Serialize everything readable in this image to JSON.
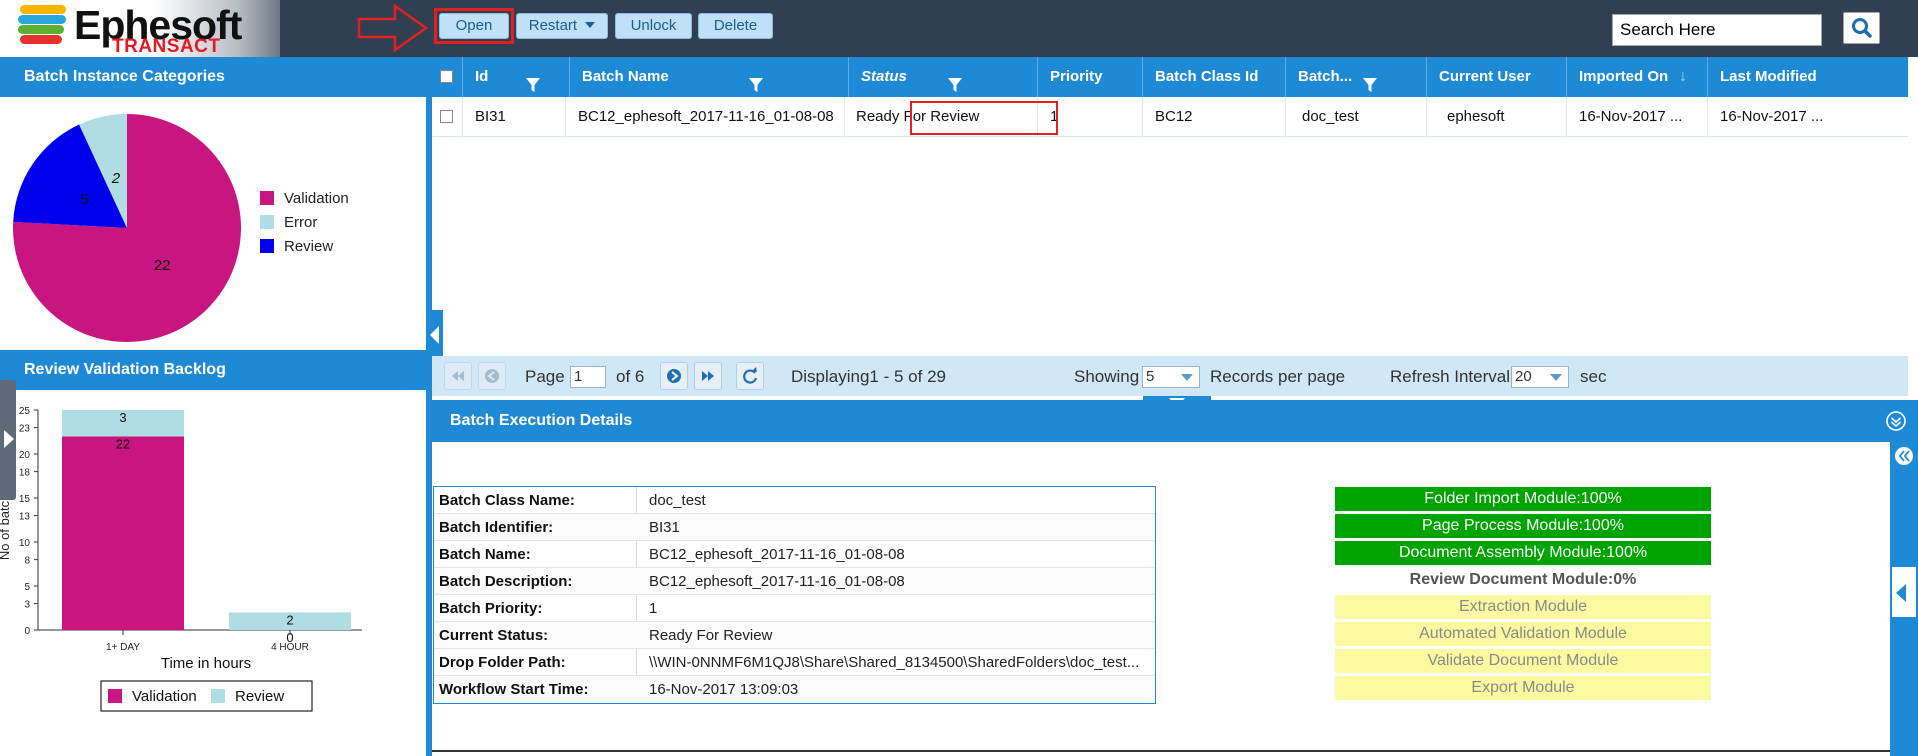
{
  "app": {
    "logo_title": "Ephesoft",
    "logo_sub": "TRANSACT"
  },
  "toolbar": {
    "open": "Open",
    "restart": "Restart",
    "unlock": "Unlock",
    "delete": "Delete"
  },
  "search": {
    "placeholder": "Search Here"
  },
  "left": {
    "categories_title": "Batch Instance Categories",
    "backlog_title": "Review Validation Backlog",
    "pie": {
      "slices": [
        {
          "name": "Validation",
          "value": 22,
          "color": "#c8157f"
        },
        {
          "name": "Error",
          "value": 2,
          "color": "#b0dde4"
        },
        {
          "name": "Review",
          "value": 5,
          "color": "#0000ee"
        }
      ]
    },
    "backlog": {
      "ylabel": "No of batches",
      "xlabel": "Time in hours",
      "yticks": [
        "25",
        "23",
        "20",
        "18",
        "15",
        "13",
        "10",
        "8",
        "5",
        "3",
        "0"
      ],
      "categories": [
        "1+ DAY",
        "4 HOUR"
      ],
      "series": [
        {
          "name": "Validation",
          "values": [
            22,
            0
          ],
          "color": "#c8157f"
        },
        {
          "name": "Review",
          "values": [
            3,
            2
          ],
          "color": "#b0dde4"
        }
      ],
      "ymax": 25
    }
  },
  "chart_data": [
    {
      "type": "pie",
      "title": "Batch Instance Categories",
      "categories": [
        "Validation",
        "Error",
        "Review"
      ],
      "values": [
        22,
        2,
        5
      ],
      "legend": "right"
    },
    {
      "type": "bar",
      "title": "Review Validation Backlog",
      "categories": [
        "1+ DAY",
        "4 HOUR"
      ],
      "series": [
        {
          "name": "Validation",
          "values": [
            22,
            0
          ]
        },
        {
          "name": "Review",
          "values": [
            3,
            2
          ]
        }
      ],
      "xlabel": "Time in hours",
      "ylabel": "No of batches",
      "ylim": [
        0,
        25
      ],
      "stacked": true,
      "legend": "bottom"
    }
  ],
  "grid": {
    "columns": {
      "id": "Id",
      "batch_name": "Batch Name",
      "status": "Status",
      "priority": "Priority",
      "batch_class_id": "Batch Class Id",
      "batch_desc": "Batch...",
      "current_user": "Current User",
      "imported_on": "Imported On",
      "last_modified": "Last Modified"
    },
    "row": {
      "id": "BI31",
      "batch_name": "BC12_ephesoft_2017-11-16_01-08-08",
      "status": "Ready For Review",
      "priority": "1",
      "batch_class_id": "BC12",
      "batch_desc": "doc_test",
      "current_user": "ephesoft",
      "imported_on": "16-Nov-2017 ...",
      "last_modified": "16-Nov-2017 ..."
    }
  },
  "pager": {
    "page_label": "Page",
    "page_value": "1",
    "of_label": "of 6",
    "displaying": "Displaying1 - 5 of 29",
    "showing_label": "Showing",
    "showing_value": "5",
    "records_label": "Records per page",
    "refresh_label": "Refresh Interval",
    "refresh_value": "20",
    "sec_label": "sec"
  },
  "exec": {
    "title": "Batch Execution Details",
    "details": [
      {
        "label": "Batch Class Name:",
        "value": "doc_test"
      },
      {
        "label": "Batch Identifier:",
        "value": "BI31"
      },
      {
        "label": "Batch Name:",
        "value": "BC12_ephesoft_2017-11-16_01-08-08"
      },
      {
        "label": "Batch Description:",
        "value": "BC12_ephesoft_2017-11-16_01-08-08"
      },
      {
        "label": "Batch Priority:",
        "value": "1"
      },
      {
        "label": "Current Status:",
        "value": "Ready For Review"
      },
      {
        "label": "Drop Folder Path:",
        "value": "\\\\WIN-0NNMF6M1QJ8\\Share\\Shared_8134500\\SharedFolders\\doc_test..."
      },
      {
        "label": "Workflow Start Time:",
        "value": "16-Nov-2017 13:09:03"
      }
    ],
    "modules": [
      {
        "label": "Folder Import Module:100%",
        "state": "done"
      },
      {
        "label": "Page Process Module:100%",
        "state": "done"
      },
      {
        "label": "Document Assembly Module:100%",
        "state": "done"
      },
      {
        "label": "Review Document Module:0%",
        "state": "active"
      },
      {
        "label": "Extraction Module",
        "state": "pending"
      },
      {
        "label": "Automated Validation Module",
        "state": "pending"
      },
      {
        "label": "Validate Document Module",
        "state": "pending"
      },
      {
        "label": "Export Module",
        "state": "pending"
      }
    ]
  },
  "colors": {
    "header_blue": "#1e8ad6",
    "topbar": "#303f51",
    "validation": "#c8157f",
    "review_light": "#b0dde4",
    "review_blue": "#0000ee",
    "module_done": "#00a400",
    "module_pending": "#fbfaa0",
    "highlight_red": "#e32020"
  }
}
